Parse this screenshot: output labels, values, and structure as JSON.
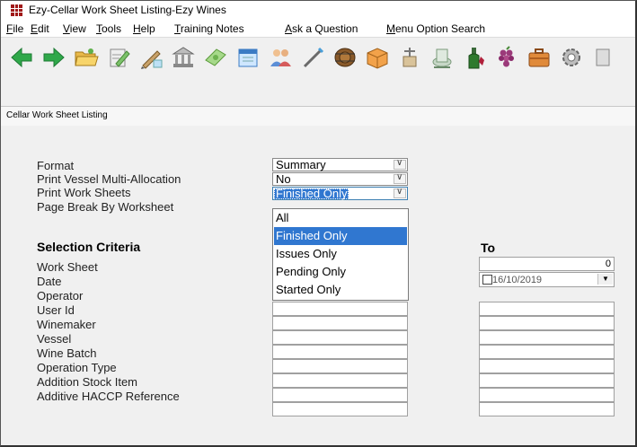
{
  "window": {
    "title": "Ezy-Cellar Work Sheet Listing-Ezy Wines"
  },
  "menu": [
    {
      "pre": "",
      "key": "F",
      "post": "ile"
    },
    {
      "pre": "",
      "key": "E",
      "post": "dit"
    },
    {
      "pre": "",
      "key": "V",
      "post": "iew"
    },
    {
      "pre": "",
      "key": "T",
      "post": "ools"
    },
    {
      "pre": "",
      "key": "H",
      "post": "elp"
    },
    {
      "pre": "",
      "key": "T",
      "post": "raining Notes"
    },
    {
      "pre": "",
      "key": "A",
      "post": "sk a Question"
    },
    {
      "pre": "",
      "key": "M",
      "post": "enu Option Search"
    }
  ],
  "toolbar": {
    "icons": [
      "back-arrow-icon",
      "forward-arrow-icon",
      "open-folder-icon",
      "edit-document-icon",
      "pen-icon",
      "bank-icon",
      "money-icon",
      "calendar-icon",
      "people-icon",
      "wand-icon",
      "barrel-icon",
      "box-icon",
      "grape-press-icon",
      "tank-icon",
      "wine-bottle-icon",
      "grapes-icon",
      "briefcase-icon",
      "settings-icon"
    ]
  },
  "tab": {
    "label": "Cellar Work Sheet Listing"
  },
  "form": {
    "format_label": "Format",
    "format_value": "Summary",
    "multi_alloc_label": "Print Vessel Multi-Allocation",
    "multi_alloc_value": "No",
    "print_ws_label": "Print Work Sheets",
    "print_ws_value": "Finished Only",
    "page_break_label": "Page Break By Worksheet",
    "dropdown_options": [
      "All",
      "Finished Only",
      "Issues Only",
      "Pending Only",
      "Started Only"
    ],
    "dropdown_selected": "Finished Only",
    "selection_header": "Selection Criteria",
    "to_header": "To",
    "criteria": [
      "Work Sheet",
      "Date",
      "Operator",
      "User Id",
      "Winemaker",
      "Vessel",
      "Wine Batch",
      "Operation Type",
      "Addition Stock Item",
      "Additive HACCP Reference"
    ],
    "worksheet_to_value": "0",
    "date_to_value": "16/10/2019"
  },
  "colors": {
    "selection": "#3077d0",
    "accent": "#a01818"
  }
}
